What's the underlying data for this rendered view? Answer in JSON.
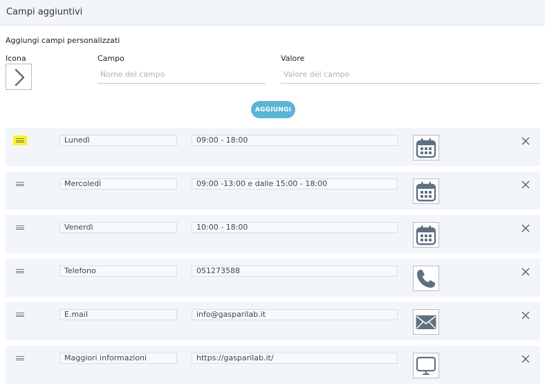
{
  "header": {
    "title": "Campi aggiuntivi"
  },
  "form": {
    "subtitle": "Aggiungi campi personalizzati",
    "icon_label": "Icona",
    "field_label": "Campo",
    "field_placeholder": "Nome del campo",
    "value_label": "Valore",
    "value_placeholder": "Valore del campo",
    "add_button": "AGGIUNGI"
  },
  "rows": [
    {
      "campo": "Lunedì",
      "valore": "09:00 - 18:00",
      "icon": "calendar-icon"
    },
    {
      "campo": "Mercoledì",
      "valore": "09:00 -13:00 e dalle 15:00 - 18:00",
      "icon": "calendar-icon"
    },
    {
      "campo": "Venerdì",
      "valore": "10:00 - 18:00",
      "icon": "calendar-icon"
    },
    {
      "campo": "Telefono",
      "valore": "051273588",
      "icon": "phone-icon"
    },
    {
      "campo": "E.mail",
      "valore": "info@gasparilab.it",
      "icon": "envelope-icon"
    },
    {
      "campo": "Maggiori informazioni",
      "valore": "https://gasparilab.it/",
      "icon": "monitor-icon"
    }
  ],
  "colors": {
    "header_bg": "#f2f5fa",
    "row_bg": "#f2f5fa",
    "button_bg": "#5bb5d5",
    "icon_color": "#607080",
    "drag_highlight": "#f5f523"
  }
}
